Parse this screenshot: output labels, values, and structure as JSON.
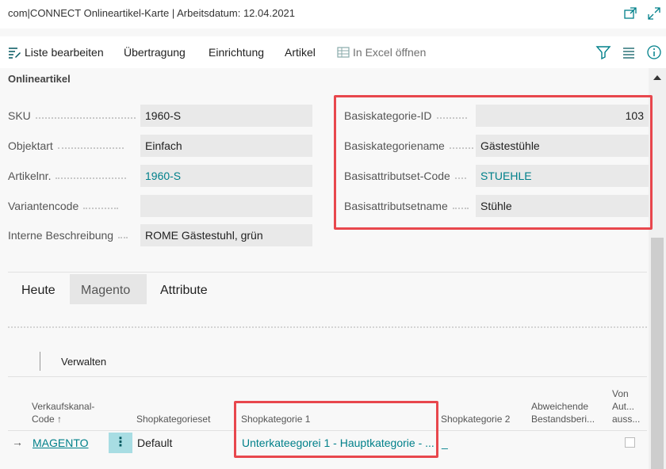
{
  "window": {
    "title": "com|CONNECT Onlineartikel-Karte | Arbeitsdatum: 12.04.2021"
  },
  "actions": {
    "edit_list": "Liste bearbeiten",
    "transfer": "Übertragung",
    "setup": "Einrichtung",
    "item": "Artikel",
    "open_excel": "In Excel öffnen"
  },
  "section": {
    "title": "Onlineartikel"
  },
  "left_fields": [
    {
      "label": "SKU",
      "value": "1960-S"
    },
    {
      "label": "Objektart",
      "value": "Einfach"
    },
    {
      "label": "Artikelnr.",
      "value": "1960-S"
    },
    {
      "label": "Variantencode",
      "value": ""
    },
    {
      "label": "Interne Beschreibung",
      "value": "ROME Gästestuhl, grün"
    }
  ],
  "right_fields": [
    {
      "label": "Basiskategorie-ID",
      "value": "103"
    },
    {
      "label": "Basiskategoriename",
      "value": "Gästestühle"
    },
    {
      "label": "Basisattributset-Code",
      "value": "STUEHLE"
    },
    {
      "label": "Basisattributsetname",
      "value": "Stühle"
    }
  ],
  "tabs": [
    "Heute",
    "Magento",
    "Attribute"
  ],
  "subpage": {
    "manage": "Verwalten",
    "columns": {
      "channel_code_line1": "Verkaufskanal-",
      "channel_code_line2": "Code ↑",
      "category_set": "Shopkategorieset",
      "category1": "Shopkategorie 1",
      "category2": "Shopkategorie 2",
      "different_stock_line1": "Abweichende",
      "different_stock_line2": "Bestandsberi...",
      "from_auto_line1": "Von",
      "from_auto_line2": "Aut...",
      "from_auto_line3": "auss..."
    },
    "row": {
      "arrow": "→",
      "channel_code": "MAGENTO",
      "menu": "⋮",
      "category_set": "Default",
      "category1": "Unterkateegorei 1 - Hauptkategorie - ...",
      "category2": "_"
    }
  },
  "colors": {
    "highlight": "#e8474d",
    "link": "#00808a",
    "row_menu": "#a8dde3"
  }
}
